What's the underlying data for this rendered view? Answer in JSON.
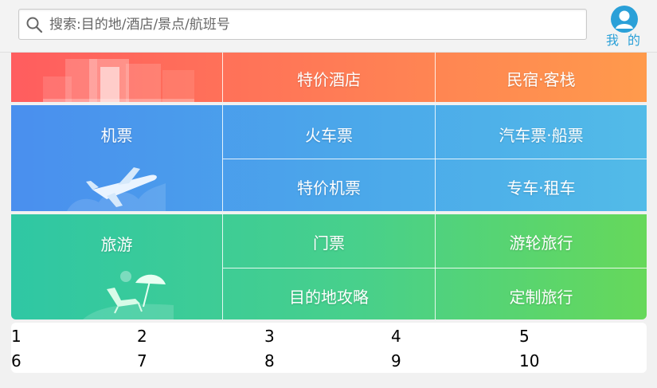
{
  "search": {
    "placeholder": "搜索:目的地/酒店/景点/航班号"
  },
  "profile": {
    "label": "我 的"
  },
  "hotel_row": {
    "items": [
      "特价酒店",
      "民宿·客栈"
    ]
  },
  "flight_row": {
    "main": "机票",
    "items": [
      "火车票",
      "汽车票·船票",
      "特价机票",
      "专车·租车"
    ]
  },
  "travel_row": {
    "main": "旅游",
    "items": [
      "门票",
      "游轮旅行",
      "目的地攻略",
      "定制旅行"
    ]
  },
  "numbers": [
    "1",
    "2",
    "3",
    "4",
    "5",
    "6",
    "7",
    "8",
    "9",
    "10"
  ],
  "colors": {
    "accent": "#2aa0d8",
    "hotel": "#ff6f59",
    "flight": "#4ba2ec",
    "travel": "#44cd8e"
  }
}
